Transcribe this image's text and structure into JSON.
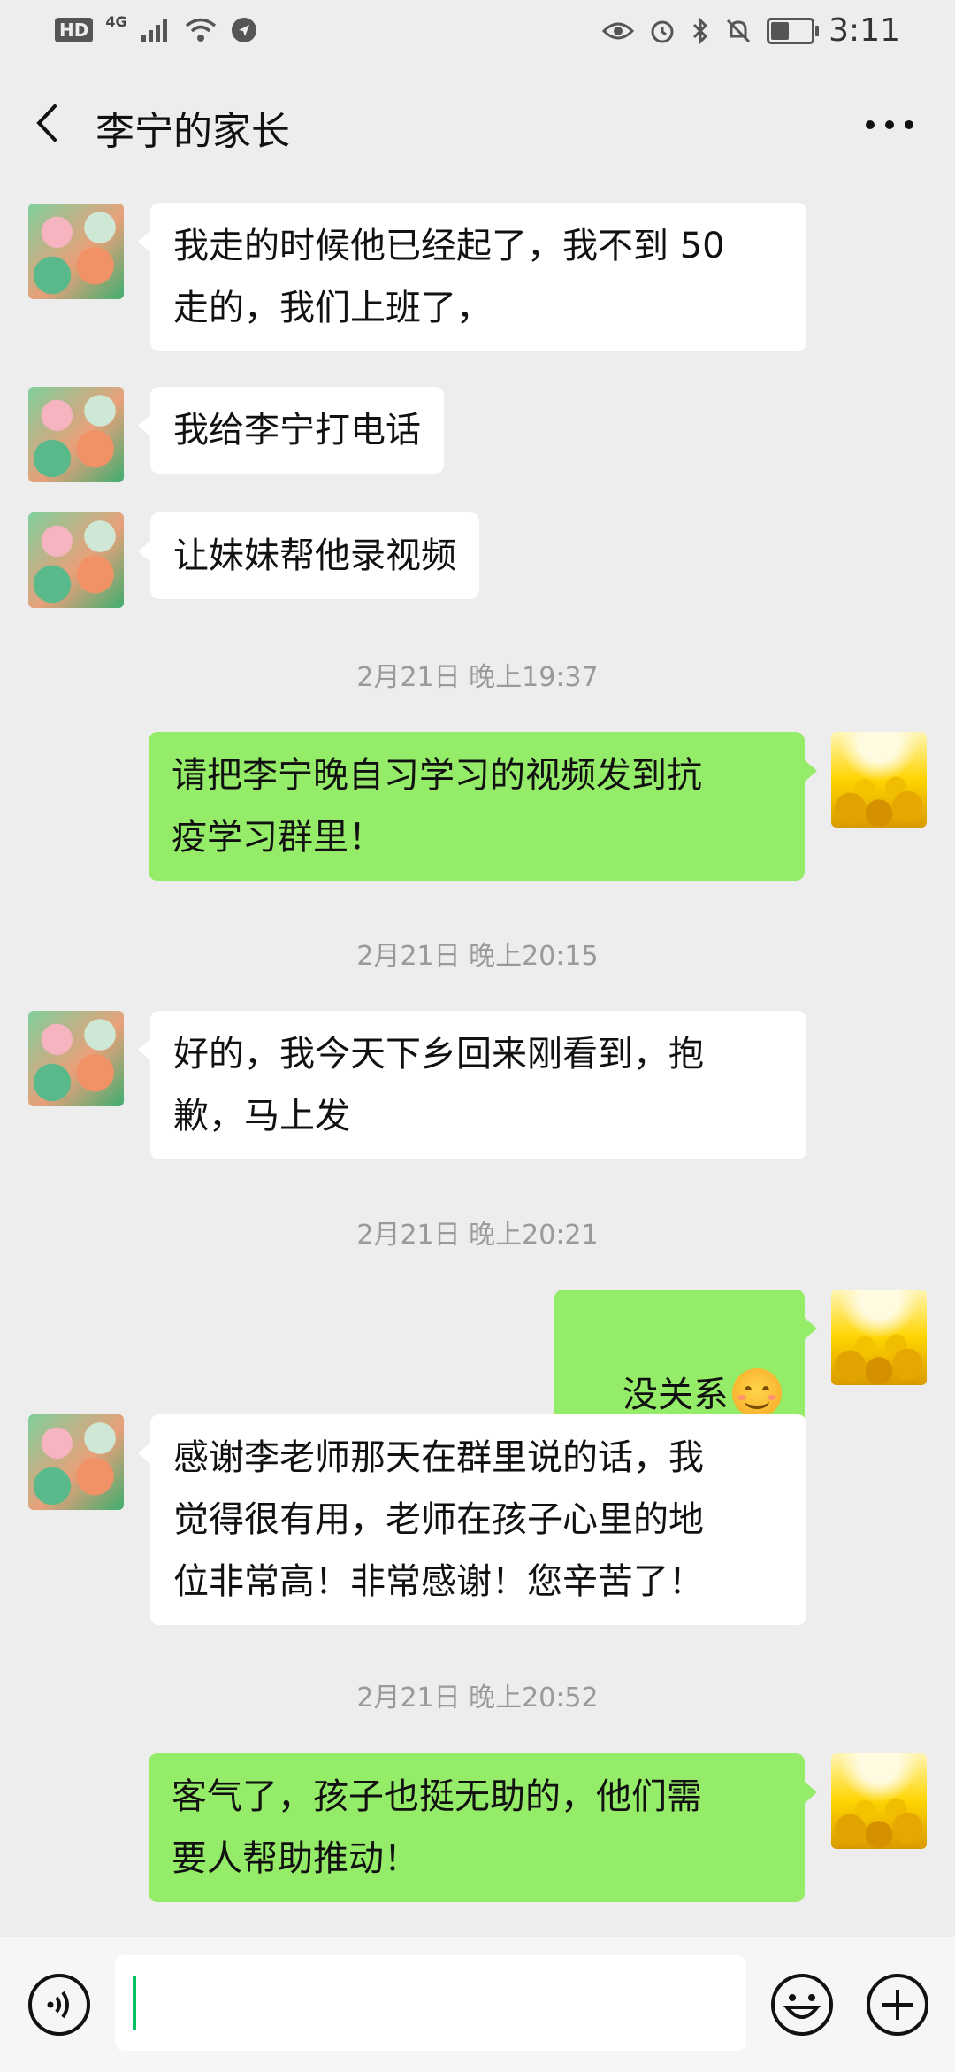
{
  "status_bar": {
    "hd_label": "HD",
    "network_label": "4G",
    "time": "3:11"
  },
  "header": {
    "title": "李宁的家长",
    "back_icon": "chevron-left-icon",
    "more_icon": "more-horizontal-icon"
  },
  "messages": [
    {
      "type": "text",
      "sender": "other",
      "text": "我走的时候他已经起了，我不到 50\n走的，我们上班了，"
    },
    {
      "type": "text",
      "sender": "other",
      "text": "我给李宁打电话"
    },
    {
      "type": "text",
      "sender": "other",
      "text": "让妹妹帮他录视频"
    },
    {
      "type": "time",
      "text": "2月21日 晚上19:37"
    },
    {
      "type": "text",
      "sender": "self",
      "text": "请把李宁晚自习学习的视频发到抗\n疫学习群里！"
    },
    {
      "type": "time",
      "text": "2月21日 晚上20:15"
    },
    {
      "type": "text",
      "sender": "other",
      "text": "好的，我今天下乡回来刚看到，抱\n歉，马上发"
    },
    {
      "type": "time",
      "text": "2月21日 晚上20:21"
    },
    {
      "type": "text",
      "sender": "self",
      "text": "没关系",
      "emoji": "smile-emoji"
    },
    {
      "type": "text",
      "sender": "other",
      "text": "感谢李老师那天在群里说的话，我\n觉得很有用，老师在孩子心里的地\n位非常高！非常感谢！您辛苦了！"
    },
    {
      "type": "time",
      "text": "2月21日 晚上20:52"
    },
    {
      "type": "text",
      "sender": "self",
      "text": "客气了，孩子也挺无助的，他们需\n要人帮助推动！"
    }
  ],
  "input_bar": {
    "voice_icon": "voice-icon",
    "emoji_icon": "emoji-icon",
    "plus_icon": "plus-icon",
    "input_value": ""
  },
  "colors": {
    "background": "#ededed",
    "self_bubble": "#95ec69",
    "other_bubble": "#ffffff",
    "cursor": "#07c160"
  }
}
